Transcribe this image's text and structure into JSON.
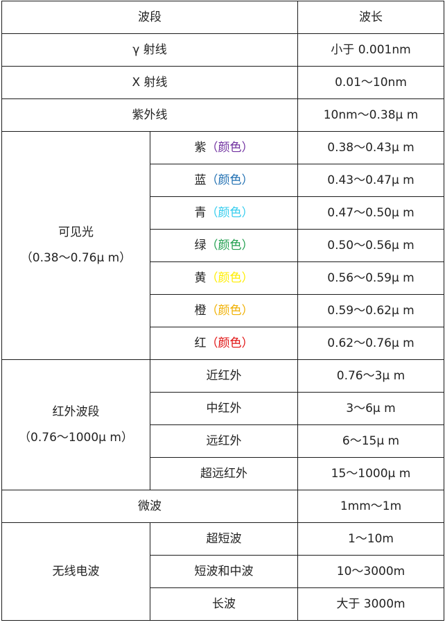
{
  "header": {
    "band": "波段",
    "wavelength": "波长"
  },
  "rows": {
    "gamma": {
      "name": "γ  射线",
      "wavelength": "小于 0.001nm"
    },
    "xray": {
      "name": "X 射线",
      "wavelength": "0.01～10nm"
    },
    "uv": {
      "name": "紫外线",
      "wavelength": "10nm～0.38μ  m"
    },
    "visible": {
      "name": "可见光",
      "range": "（0.38～0.76μ  m）",
      "colors": [
        {
          "name": "紫",
          "note": "（颜色）",
          "color": "#7030a0",
          "wavelength": "0.38～0.43μ  m"
        },
        {
          "name": "蓝",
          "note": "（颜色）",
          "color": "#1f6fb2",
          "wavelength": "0.43～0.47μ  m"
        },
        {
          "name": "青",
          "note": "（颜色）",
          "color": "#33ccee",
          "wavelength": "0.47～0.50μ  m"
        },
        {
          "name": "绿",
          "note": "（颜色）",
          "color": "#1f9e4d",
          "wavelength": "0.50～0.56μ  m"
        },
        {
          "name": "黄",
          "note": "（颜色）",
          "color": "#ffee00",
          "wavelength": "0.56～0.59μ  m"
        },
        {
          "name": "橙",
          "note": "（颜色）",
          "color": "#f0b000",
          "wavelength": "0.59～0.62μ  m"
        },
        {
          "name": "红",
          "note": "（颜色）",
          "color": "#e01010",
          "wavelength": "0.62～0.76μ  m"
        }
      ]
    },
    "infrared": {
      "name": "红外波段",
      "range": "（0.76～1000μ  m）",
      "subs": [
        {
          "name": "近红外",
          "wavelength": "0.76～3μ  m"
        },
        {
          "name": "中红外",
          "wavelength": "3～6μ  m"
        },
        {
          "name": "远红外",
          "wavelength": "6～15μ  m"
        },
        {
          "name": "超远红外",
          "wavelength": "15～1000μ  m"
        }
      ]
    },
    "microwave": {
      "name": "微波",
      "wavelength": "1mm～1m"
    },
    "radio": {
      "name": "无线电波",
      "subs": [
        {
          "name": "超短波",
          "wavelength": "1～10m"
        },
        {
          "name": "短波和中波",
          "wavelength": "10～3000m"
        },
        {
          "name": "长波",
          "wavelength": "大于 3000m"
        }
      ]
    }
  }
}
